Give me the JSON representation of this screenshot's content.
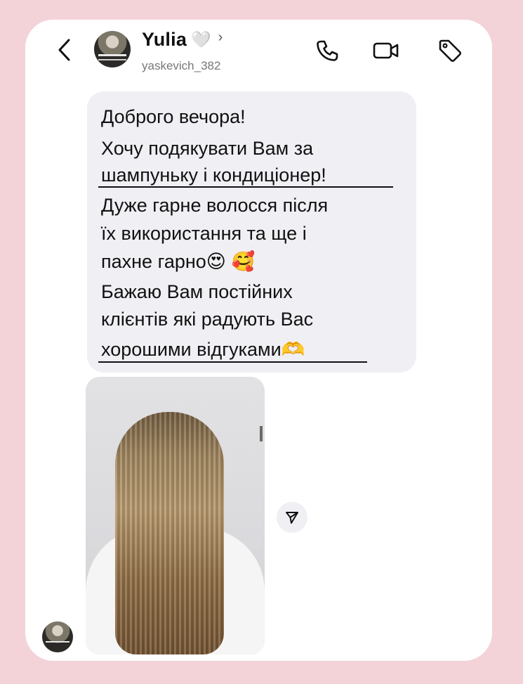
{
  "header": {
    "name": "Yulia",
    "heart": "🤍",
    "chevron": "›",
    "username": "yaskevich_382",
    "icons": {
      "back": "chevron-left-icon",
      "call": "phone-icon",
      "video": "video-camera-icon",
      "tag": "tag-icon"
    }
  },
  "message": {
    "lines": [
      "Доброго вечора!",
      "Хочу подякувати Вам за",
      "шампуньку і кондиціонер!",
      "Дуже гарне волосся після",
      "їх використання та ще і",
      "пахне гарно",
      "Бажаю Вам постійних",
      "клієнтів які радують Вас",
      "хорошими відгуками"
    ],
    "emojis": {
      "heart_eyes": "😍",
      "smiling_hearts": "🥰",
      "heart_hands": "🫶"
    }
  },
  "photo": {
    "description_icon": "hair-photo"
  },
  "colors": {
    "frame": "#f3d3d8",
    "bubble": "#efeff4",
    "text": "#111111",
    "username": "#777777"
  }
}
